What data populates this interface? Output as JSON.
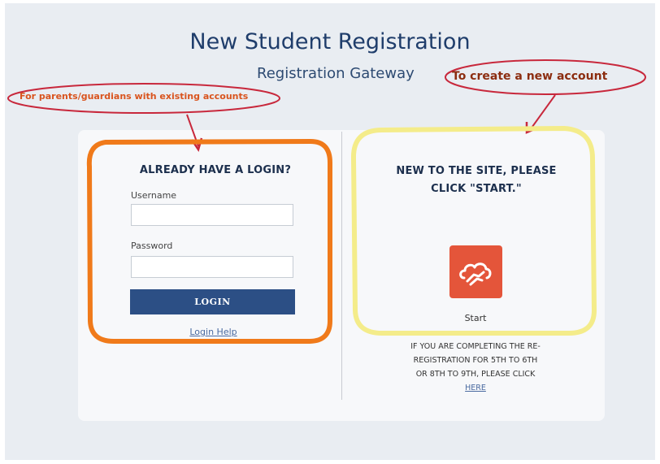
{
  "header": {
    "title": "New Student Registration",
    "subtitle": "Registration Gateway"
  },
  "annotations": {
    "left_callout": "For parents/guardians with existing accounts",
    "right_callout": "To create a new account",
    "colors": {
      "callout_ellipse": "#c8283c",
      "left_highlight": "#f07a1a",
      "right_highlight": "#f4ec8a"
    }
  },
  "login": {
    "heading": "ALREADY HAVE A LOGIN?",
    "username_label": "Username",
    "username_value": "",
    "password_label": "Password",
    "password_value": "",
    "login_button": "LOGIN",
    "help_link": "Login Help"
  },
  "new_account": {
    "heading_line1": "NEW TO THE SITE, PLEASE",
    "heading_line2": "CLICK \"START.\"",
    "start_icon": "cloud-hand-icon",
    "start_label": "Start",
    "rereg_line1": "IF YOU ARE COMPLETING THE RE-",
    "rereg_line2": "REGISTRATION FOR 5TH TO 6TH",
    "rereg_line3": "OR 8TH TO 9TH, PLEASE CLICK",
    "here_link": "HERE"
  },
  "colors": {
    "title": "#1f3d6b",
    "button": "#2c4f85",
    "start_tile": "#e4553a",
    "background": "#e9edf2"
  }
}
